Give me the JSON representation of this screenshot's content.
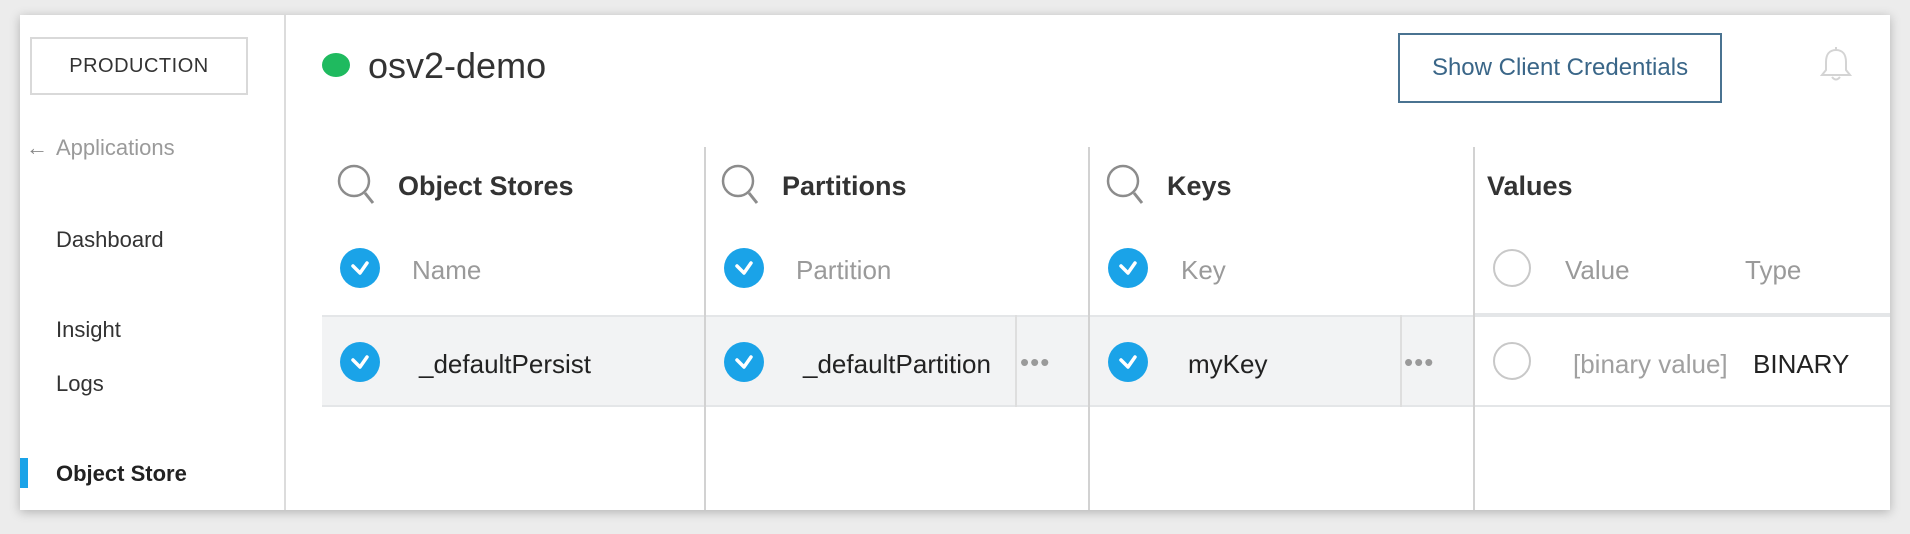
{
  "sidebar": {
    "env_button": "PRODUCTION",
    "back_link": "Applications",
    "items": [
      {
        "label": "Dashboard"
      },
      {
        "label": "Insight"
      },
      {
        "label": "Logs"
      },
      {
        "label": "Object Store",
        "active": true
      }
    ]
  },
  "header": {
    "app_name": "osv2-demo",
    "status_color": "#1fba5f",
    "credentials_button": "Show Client Credentials"
  },
  "columns": {
    "object_stores": {
      "title": "Object Stores",
      "header_label": "Name",
      "rows": [
        "_defaultPersist"
      ]
    },
    "partitions": {
      "title": "Partitions",
      "header_label": "Partition",
      "rows": [
        "_defaultPartition"
      ]
    },
    "keys": {
      "title": "Keys",
      "header_label": "Key",
      "rows": [
        "myKey"
      ]
    },
    "values": {
      "title": "Values",
      "header_value": "Value",
      "header_type": "Type",
      "rows": [
        {
          "value": "[binary value]",
          "type": "BINARY"
        }
      ]
    }
  },
  "colors": {
    "accent": "#1aa3e8",
    "button_border": "#4a7391"
  }
}
